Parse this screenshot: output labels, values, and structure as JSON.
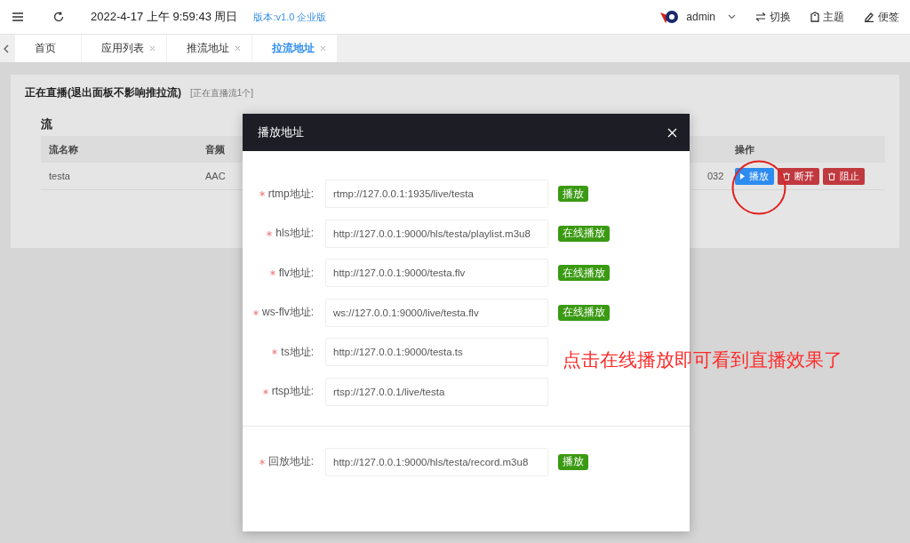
{
  "header": {
    "datetime": "2022-4-17 上午 9:59:43 周日",
    "version": "版本:v1.0 企业版",
    "user": "admin",
    "actions": [
      {
        "kind": "switch",
        "label": "切换"
      },
      {
        "kind": "theme",
        "label": "主题"
      },
      {
        "kind": "note",
        "label": "便签"
      }
    ]
  },
  "tabs": [
    {
      "label": "首页",
      "closable": false,
      "selected": false
    },
    {
      "label": "应用列表",
      "closable": true,
      "selected": false
    },
    {
      "label": "推流地址",
      "closable": true,
      "selected": false
    },
    {
      "label": "拉流地址",
      "closable": true,
      "selected": true
    }
  ],
  "panel": {
    "title": "正在直播(退出面板不影响推拉流)",
    "count": "[正在直播流1个]",
    "section": "流",
    "table": {
      "columns": [
        "流名称",
        "音频",
        "操作"
      ],
      "rows": [
        {
          "name": "testa",
          "audio": "AAC",
          "column_3": "032",
          "actions": [
            {
              "kind": "play",
              "label": "播放"
            },
            {
              "kind": "danger",
              "label": "断开"
            },
            {
              "kind": "danger",
              "label": "阻止"
            }
          ]
        }
      ]
    }
  },
  "dialog": {
    "title": "播放地址",
    "fields": [
      {
        "label": "rtmp地址:",
        "required": true,
        "value": "rtmp://127.0.0.1:1935/live/testa",
        "button": "播放"
      },
      {
        "label": "hls地址:",
        "required": true,
        "value": "http://127.0.0.1:9000/hls/testa/playlist.m3u8",
        "button": "在线播放"
      },
      {
        "label": "flv地址:",
        "required": true,
        "value": "http://127.0.0.1:9000/testa.flv",
        "button": "在线播放"
      },
      {
        "label": "ws-flv地址:",
        "required": true,
        "value": "ws://127.0.0.1:9000/live/testa.flv",
        "button": "在线播放"
      },
      {
        "label": "ts地址:",
        "required": true,
        "value": "http://127.0.0.1:9000/testa.ts"
      },
      {
        "label": "rtsp地址:",
        "required": true,
        "value": "rtsp://127.0.0.1/live/testa"
      }
    ],
    "playback": [
      {
        "label": "回放地址:",
        "required": true,
        "value": "http://127.0.0.1:9000/hls/testa/record.m3u8",
        "button": "播放"
      }
    ]
  },
  "annotation": "点击在线播放即可看到直播效果了"
}
